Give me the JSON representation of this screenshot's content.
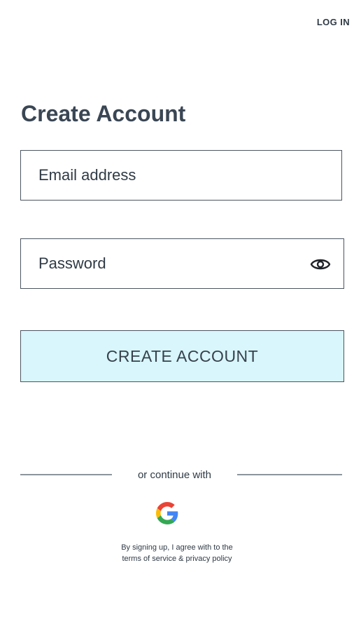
{
  "header": {
    "login_label": "LOG IN"
  },
  "title": "Create Account",
  "form": {
    "email_placeholder": "Email address",
    "password_placeholder": "Password",
    "submit_label": "CREATE ACCOUNT"
  },
  "social": {
    "divider_text": "or continue with",
    "providers": [
      "google-icon"
    ]
  },
  "terms": {
    "line1": "By signing up, I agree with to the",
    "line2": "terms of service & privacy policy"
  },
  "colors": {
    "button_bg": "#d8f6fb",
    "text": "#37414d",
    "border": "#4b5560"
  },
  "icons": {
    "password_toggle": "eye-icon",
    "social_login": "google-icon"
  }
}
